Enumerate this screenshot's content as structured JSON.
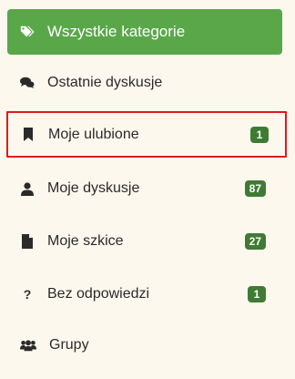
{
  "menu": {
    "items": [
      {
        "label": "Wszystkie kategorie",
        "icon": "tags-icon",
        "badge": ""
      },
      {
        "label": "Ostatnie dyskusje",
        "icon": "comments-icon",
        "badge": ""
      },
      {
        "label": "Moje ulubione",
        "icon": "bookmark-icon",
        "badge": "1"
      },
      {
        "label": "Moje dyskusje",
        "icon": "user-icon",
        "badge": "87"
      },
      {
        "label": "Moje szkice",
        "icon": "file-icon",
        "badge": "27"
      },
      {
        "label": "Bez odpowiedzi",
        "icon": "question-icon",
        "badge": "1",
        "icon_text": "?"
      },
      {
        "label": "Grupy",
        "icon": "users-icon",
        "badge": ""
      }
    ]
  },
  "colors": {
    "background": "#fdf8ee",
    "active_item": "#5aa74a",
    "badge": "#3f7b34",
    "highlight_border": "#e0191c"
  }
}
